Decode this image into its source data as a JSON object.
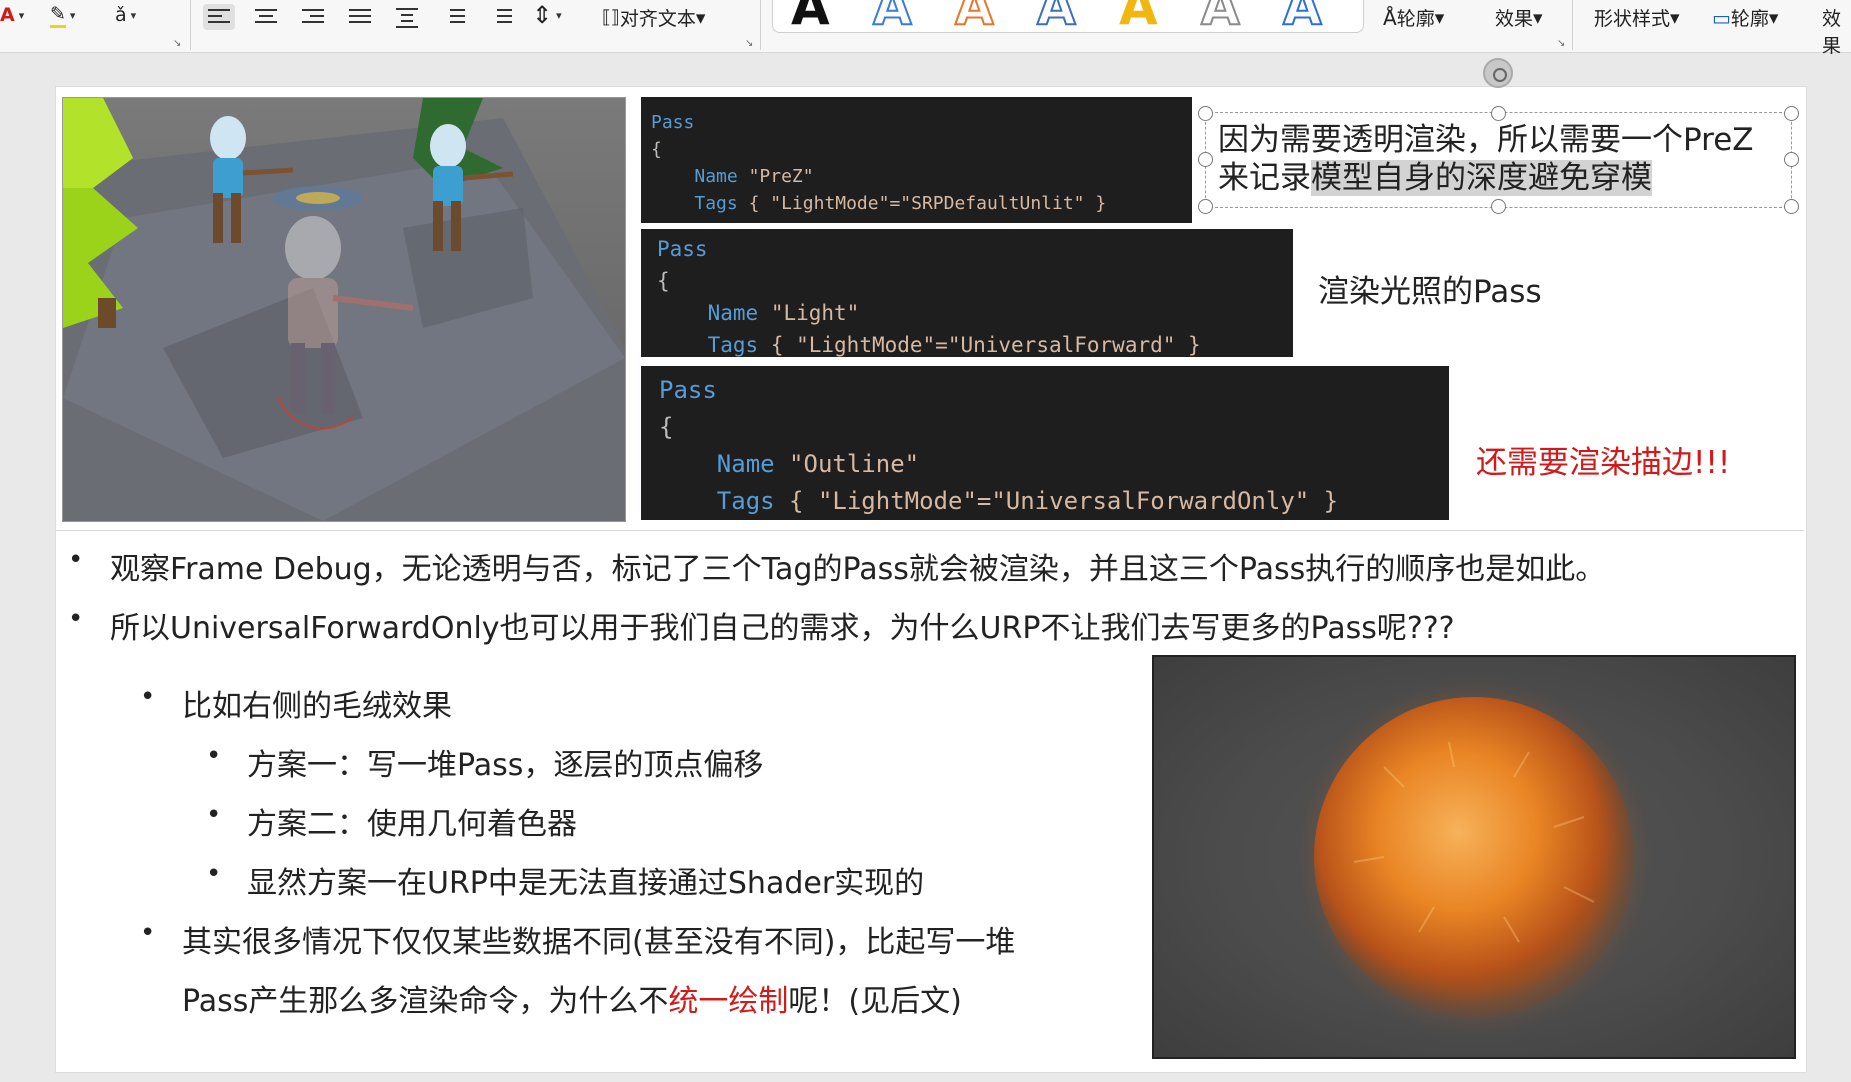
{
  "ribbon": {
    "align_text_label": "对齐文本",
    "wordart_letter": "A",
    "wordart_colors": [
      "#111111",
      "#3a7bd5",
      "#e8752b",
      "#3b6fb6",
      "#f1b710",
      "#8a8a8a",
      "#2d6fd3"
    ],
    "outline_label": "轮廓",
    "effect_label": "效果",
    "shape_style_label": "形状样式",
    "shape_outline_label": "轮廓",
    "effect2_label": "效果"
  },
  "code_blocks": [
    {
      "pass": "Pass",
      "brace": "{",
      "name_kw": "Name",
      "name_val": "\"PreZ\"",
      "tags_kw": "Tags",
      "tags_val": "{ \"LightMode\"=\"SRPDefaultUnlit\" }"
    },
    {
      "pass": "Pass",
      "brace": "{",
      "name_kw": "Name",
      "name_val": "\"Light\"",
      "tags_kw": "Tags",
      "tags_val": "{ \"LightMode\"=\"UniversalForward\" }"
    },
    {
      "pass": "Pass",
      "brace": "{",
      "name_kw": "Name",
      "name_val": "\"Outline\"",
      "tags_kw": "Tags",
      "tags_val": "{ \"LightMode\"=\"UniversalForwardOnly\" }"
    }
  ],
  "notes": {
    "prez_line1": "因为需要透明渲染，所以需要一个PreZ",
    "prez_line2_a": "来记录",
    "prez_line2_b": "模型自身的深度避免穿模",
    "light": "渲染光照的Pass",
    "outline": "还需要渲染描边!!!"
  },
  "bullets": {
    "b1": "观察Frame Debug，无论透明与否，标记了三个Tag的Pass就会被渲染，并且这三个Pass执行的顺序也是如此。",
    "b2": "所以UniversalForwardOnly也可以用于我们自己的需求，为什么URP不让我们去写更多的Pass呢???",
    "sub1": "比如右侧的毛绒效果",
    "sub1_1": "方案一：写一堆Pass，逐层的顶点偏移",
    "sub1_2": "方案二：使用几何着色器",
    "sub1_3": "显然方案一在URP中是无法直接通过Shader实现的",
    "sub2_line1": "其实很多情况下仅仅某些数据不同(甚至没有不同)，比起写一堆",
    "sub2_line2_a": "Pass产生那么多渲染命令，为什么不",
    "sub2_line2_red": "统一绘制",
    "sub2_line2_b": "呢！(见后文)"
  }
}
